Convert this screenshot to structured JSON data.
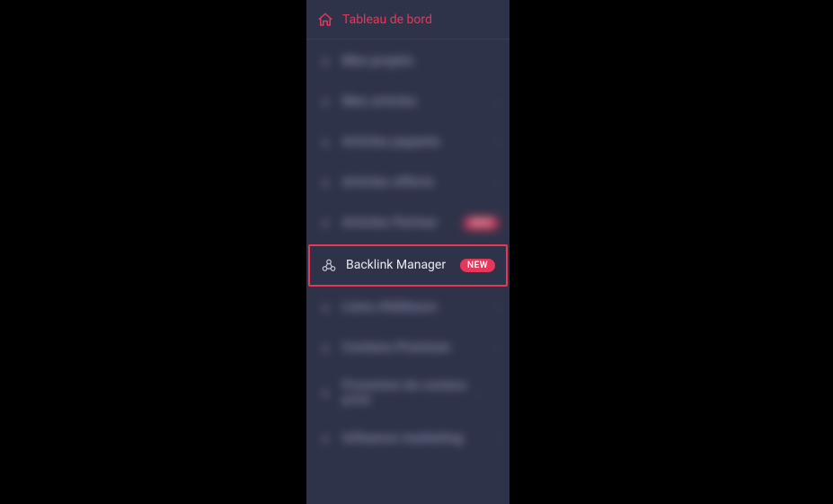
{
  "dashboard": {
    "label": "Tableau de bord"
  },
  "menu": {
    "items": [
      {
        "label": "Mes projets",
        "chev": false,
        "badge": null
      },
      {
        "label": "Mes articles",
        "chev": true,
        "badge": null
      },
      {
        "label": "Articles payants",
        "chev": true,
        "badge": null
      },
      {
        "label": "Articles offerts",
        "chev": true,
        "badge": null
      },
      {
        "label": "Articles Partner",
        "chev": false,
        "badge": "NEW"
      },
      {
        "label": "Backlink Manager",
        "chev": false,
        "badge": "NEW",
        "highlight": true
      },
      {
        "label": "Liens d'éditeurs",
        "chev": true,
        "badge": null
      },
      {
        "label": "Contenu Premium",
        "chev": true,
        "badge": null
      },
      {
        "label": "Promotion de contenu privé",
        "chev": true,
        "badge": null,
        "multi": true
      },
      {
        "label": "Influence marketing",
        "chev": true,
        "badge": null
      }
    ]
  }
}
